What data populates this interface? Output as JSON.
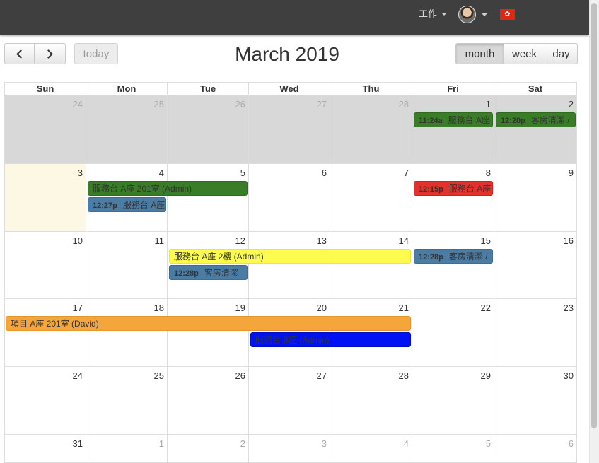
{
  "header": {
    "workspace_label": "工作",
    "flag_glyph": "✿"
  },
  "toolbar": {
    "today_label": "today",
    "title": "March 2019",
    "views": [
      "month",
      "week",
      "day"
    ],
    "active_view": "month"
  },
  "weekdays": [
    "Sun",
    "Mon",
    "Tue",
    "Wed",
    "Thu",
    "Fri",
    "Sat"
  ],
  "weeks": [
    [
      "24",
      "25",
      "26",
      "27",
      "28",
      "1",
      "2"
    ],
    [
      "3",
      "4",
      "5",
      "6",
      "7",
      "8",
      "9"
    ],
    [
      "10",
      "11",
      "12",
      "13",
      "14",
      "15",
      "16"
    ],
    [
      "17",
      "18",
      "19",
      "20",
      "21",
      "22",
      "23"
    ],
    [
      "24",
      "25",
      "26",
      "27",
      "28",
      "29",
      "30"
    ],
    [
      "31",
      "1",
      "2",
      "3",
      "4",
      "5",
      "6"
    ]
  ],
  "today_date": "3",
  "events": [
    {
      "time": "11:24a",
      "title": "服務台 A座",
      "color": "#3a7d28"
    },
    {
      "time": "12:20p",
      "title": "客房清潔 /",
      "color": "#3a7d28"
    },
    {
      "time": "",
      "title": "服務台 A座 201室 (Admin)",
      "color": "#3a7d28"
    },
    {
      "time": "12:27p",
      "title": "服務台 A座",
      "color": "#4b7ca3"
    },
    {
      "time": "12:15p",
      "title": "服務台 A座",
      "color": "#e3312c"
    },
    {
      "time": "",
      "title": "服務台 A座 2樓 (Admin)",
      "color": "#fdfc4e"
    },
    {
      "time": "12:28p",
      "title": "客房清潔",
      "color": "#4b7ca3"
    },
    {
      "time": "12:28p",
      "title": "客房清潔 /",
      "color": "#4b7ca3"
    },
    {
      "time": "",
      "title": "項目 A座 201室 (David)",
      "color": "#f4a63a"
    },
    {
      "time": "",
      "title": "服務台 B座 (Admin)",
      "color": "#0012f4"
    }
  ]
}
